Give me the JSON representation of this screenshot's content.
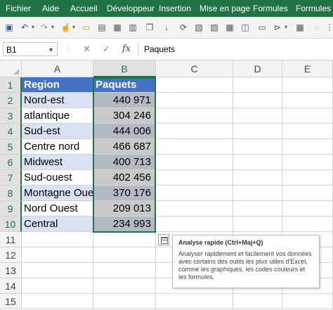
{
  "ribbon": {
    "tabs": [
      "Fichier",
      "Aide",
      "Accueil",
      "Développeur",
      "Insertion",
      "Mise en page",
      "Formules",
      "Formules"
    ]
  },
  "formula_bar": {
    "name_box": "B1",
    "cancel": "✕",
    "enter": "✓",
    "fx": "fx",
    "content": "Paquets"
  },
  "sheet": {
    "columns": [
      "A",
      "B",
      "C",
      "D",
      "E"
    ],
    "rows": [
      "1",
      "2",
      "3",
      "4",
      "5",
      "6",
      "7",
      "8",
      "9",
      "10",
      "11",
      "12",
      "13",
      "14",
      "15"
    ],
    "table": {
      "headers": [
        "Region",
        "Paquets"
      ],
      "data": [
        [
          "Nord-est",
          "440 971"
        ],
        [
          "atlantique",
          "304 246"
        ],
        [
          "Sud-est",
          "444 006"
        ],
        [
          "Centre nord",
          "466 687"
        ],
        [
          "Midwest",
          "400 713"
        ],
        [
          "Sud-ouest",
          "402 456"
        ],
        [
          "Montagne Ouest",
          "370 176"
        ],
        [
          "Nord Ouest",
          "209 013"
        ],
        [
          "Central",
          "234 993"
        ]
      ]
    }
  },
  "quick_analysis": {
    "title": "Analyse rapide (Ctrl+Maj+Q)",
    "description": "Analyser rapidement et facilement vos données avec certains des outils les plus utiles d'Excel, comme les graphiques, les codes couleurs et les formules."
  },
  "colors": {
    "ribbon": "#217346",
    "table_header": "#4472c4",
    "band": "#d9e1f2",
    "selection": "#217346"
  }
}
